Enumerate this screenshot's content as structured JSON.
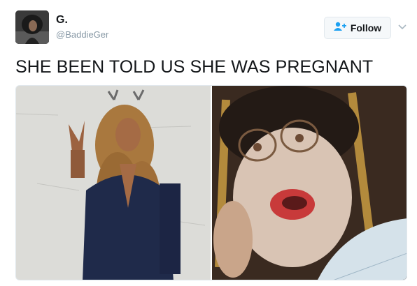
{
  "user": {
    "name": "G.",
    "handle": "@BaddieGer",
    "avatar_icon": "profile-photo"
  },
  "follow_button": {
    "label": "Follow",
    "icon": "add-user-icon",
    "icon_color": "#1da1f2"
  },
  "menu": {
    "icon": "chevron-down-icon"
  },
  "tweet": {
    "text": "SHE BEEN TOLD US SHE WAS PREGNANT"
  },
  "media": {
    "photos": [
      {
        "description_icon": "photo-left"
      },
      {
        "description_icon": "photo-right"
      }
    ]
  }
}
